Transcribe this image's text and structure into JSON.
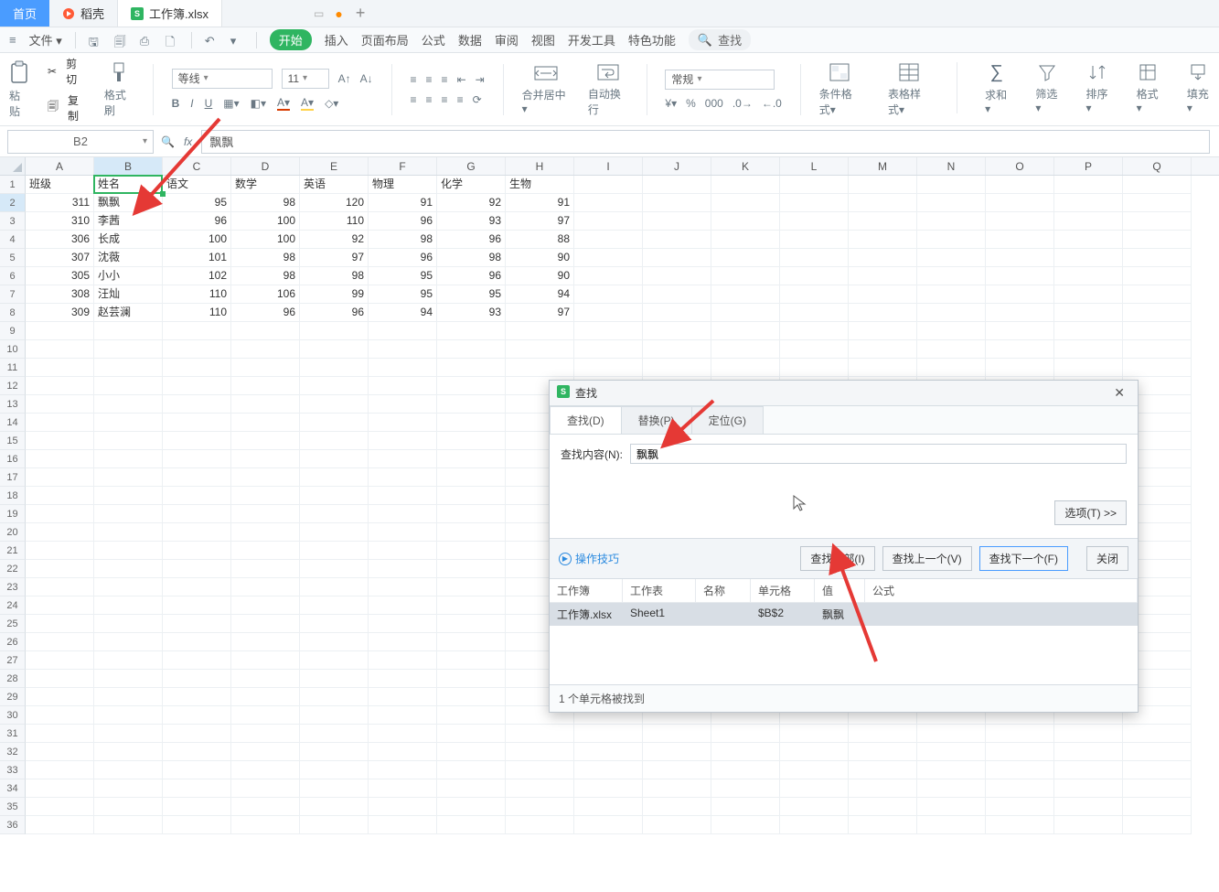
{
  "tabs": {
    "home": "首页",
    "duoke": "稻壳",
    "file": "工作簿.xlsx",
    "plus": "+"
  },
  "menubar": {
    "file": "文件",
    "start": "开始",
    "items": [
      "插入",
      "页面布局",
      "公式",
      "数据",
      "审阅",
      "视图",
      "开发工具",
      "特色功能"
    ],
    "search": "查找"
  },
  "ribbon": {
    "clipboard": {
      "cut": "剪切",
      "copy": "复制",
      "format_painter": "格式刷",
      "paste": "粘贴"
    },
    "font": {
      "name": "等线",
      "size": "11"
    },
    "merge": "合并居中",
    "wrap": "自动换行",
    "number_format": "常规",
    "groups": {
      "cond": "条件格式",
      "tablestyle": "表格样式",
      "sum": "求和",
      "filter": "筛选",
      "sort": "排序",
      "format": "格式",
      "fill": "填充"
    }
  },
  "namebox": "B2",
  "formula": "飘飘",
  "columns": [
    "A",
    "B",
    "C",
    "D",
    "E",
    "F",
    "G",
    "H",
    "I",
    "J",
    "K",
    "L",
    "M",
    "N",
    "O",
    "P",
    "Q"
  ],
  "header_row": [
    "班级",
    "姓名",
    "语文",
    "数学",
    "英语",
    "物理",
    "化学",
    "生物"
  ],
  "rows": [
    {
      "a": "311",
      "b": "飘飘",
      "c": "95",
      "d": "98",
      "e": "120",
      "f": "91",
      "g": "92",
      "h": "91"
    },
    {
      "a": "310",
      "b": "李茜",
      "c": "96",
      "d": "100",
      "e": "110",
      "f": "96",
      "g": "93",
      "h": "97"
    },
    {
      "a": "306",
      "b": "长成",
      "c": "100",
      "d": "100",
      "e": "92",
      "f": "98",
      "g": "96",
      "h": "88"
    },
    {
      "a": "307",
      "b": "沈薇",
      "c": "101",
      "d": "98",
      "e": "97",
      "f": "96",
      "g": "98",
      "h": "90"
    },
    {
      "a": "305",
      "b": "小小",
      "c": "102",
      "d": "98",
      "e": "98",
      "f": "95",
      "g": "96",
      "h": "90"
    },
    {
      "a": "308",
      "b": "汪灿",
      "c": "110",
      "d": "106",
      "e": "99",
      "f": "95",
      "g": "95",
      "h": "94"
    },
    {
      "a": "309",
      "b": "赵芸澜",
      "c": "110",
      "d": "96",
      "e": "96",
      "f": "94",
      "g": "93",
      "h": "97"
    }
  ],
  "dialog": {
    "title": "查找",
    "tabs": {
      "find": "查找(D)",
      "replace": "替换(P)",
      "goto": "定位(G)"
    },
    "find_label": "查找内容(N):",
    "find_value": "飘飘",
    "options_btn": "选项(T) >>",
    "tips": "操作技巧",
    "buttons": {
      "find_all": "查找全部(I)",
      "find_prev": "查找上一个(V)",
      "find_next": "查找下一个(F)",
      "close": "关闭"
    },
    "result_headers": {
      "wb": "工作簿",
      "ws": "工作表",
      "name": "名称",
      "cell": "单元格",
      "value": "值",
      "formula": "公式"
    },
    "result_row": {
      "wb": "工作簿.xlsx",
      "ws": "Sheet1",
      "name": "",
      "cell": "$B$2",
      "value": "飘飘",
      "formula": ""
    },
    "status": "1 个单元格被找到"
  }
}
